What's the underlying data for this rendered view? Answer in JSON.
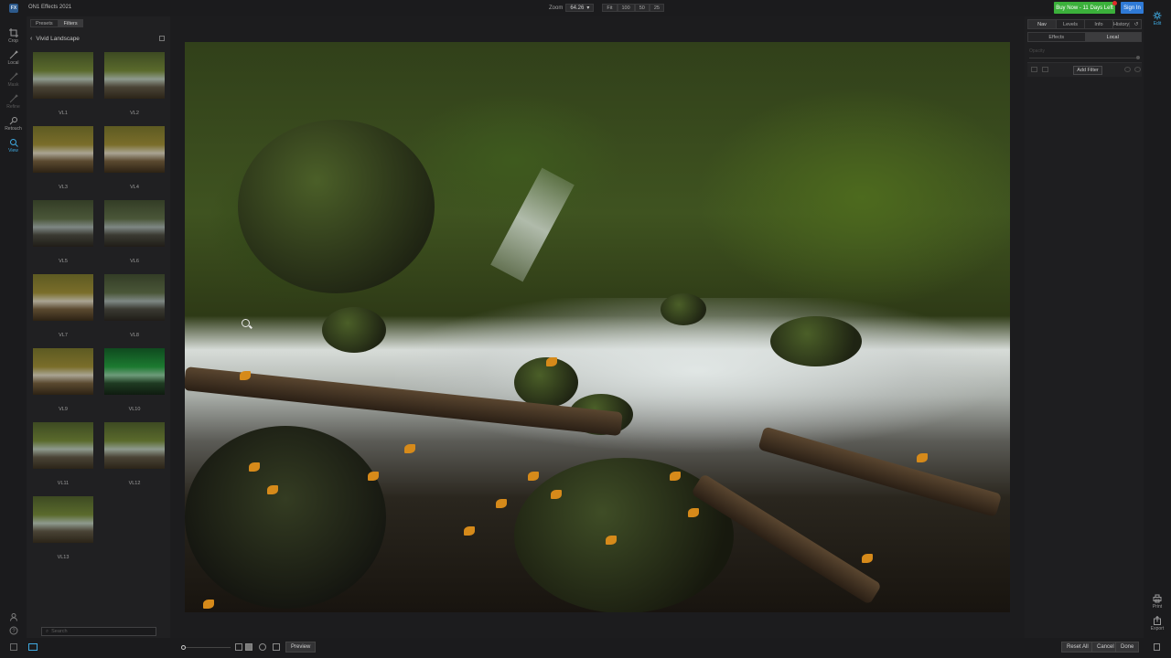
{
  "topbar": {
    "logo": "FX",
    "app_title": "ON1 Effects 2021",
    "zoom_label": "Zoom",
    "zoom_value": "64.26",
    "zoom_presets": [
      "Fit",
      "100",
      "50",
      "25"
    ],
    "buy_label": "Buy Now - 11 Days Left",
    "signin_label": "Sign In"
  },
  "rail": {
    "tools": [
      "Crop",
      "Local",
      "Mask",
      "Refine",
      "Retouch",
      "View"
    ]
  },
  "browser": {
    "tabs": [
      "Presets",
      "Filters"
    ],
    "category": "Vivid Landscape",
    "presets": [
      "VL1",
      "VL2",
      "VL3",
      "VL4",
      "VL5",
      "VL6",
      "VL7",
      "VL8",
      "VL9",
      "VL10",
      "VL11",
      "VL12",
      "VL13"
    ],
    "search_placeholder": "Search"
  },
  "right_panel": {
    "tabs": [
      "Nav",
      "Levels",
      "Info",
      "History"
    ],
    "subtabs": [
      "Effects",
      "Local"
    ],
    "opacity_label": "Opacity",
    "add_filter_label": "Add Filter"
  },
  "right_rail": {
    "edit_label": "Edit",
    "print_label": "Print",
    "export_label": "Export"
  },
  "bottombar": {
    "preview_label": "Preview",
    "reset_label": "Reset All",
    "cancel_label": "Cancel",
    "done_label": "Done"
  },
  "colors": {
    "accent": "#3fa9e0",
    "buy": "#3bb03b",
    "signin": "#2f7ad6",
    "notification": "#e02b2b"
  }
}
